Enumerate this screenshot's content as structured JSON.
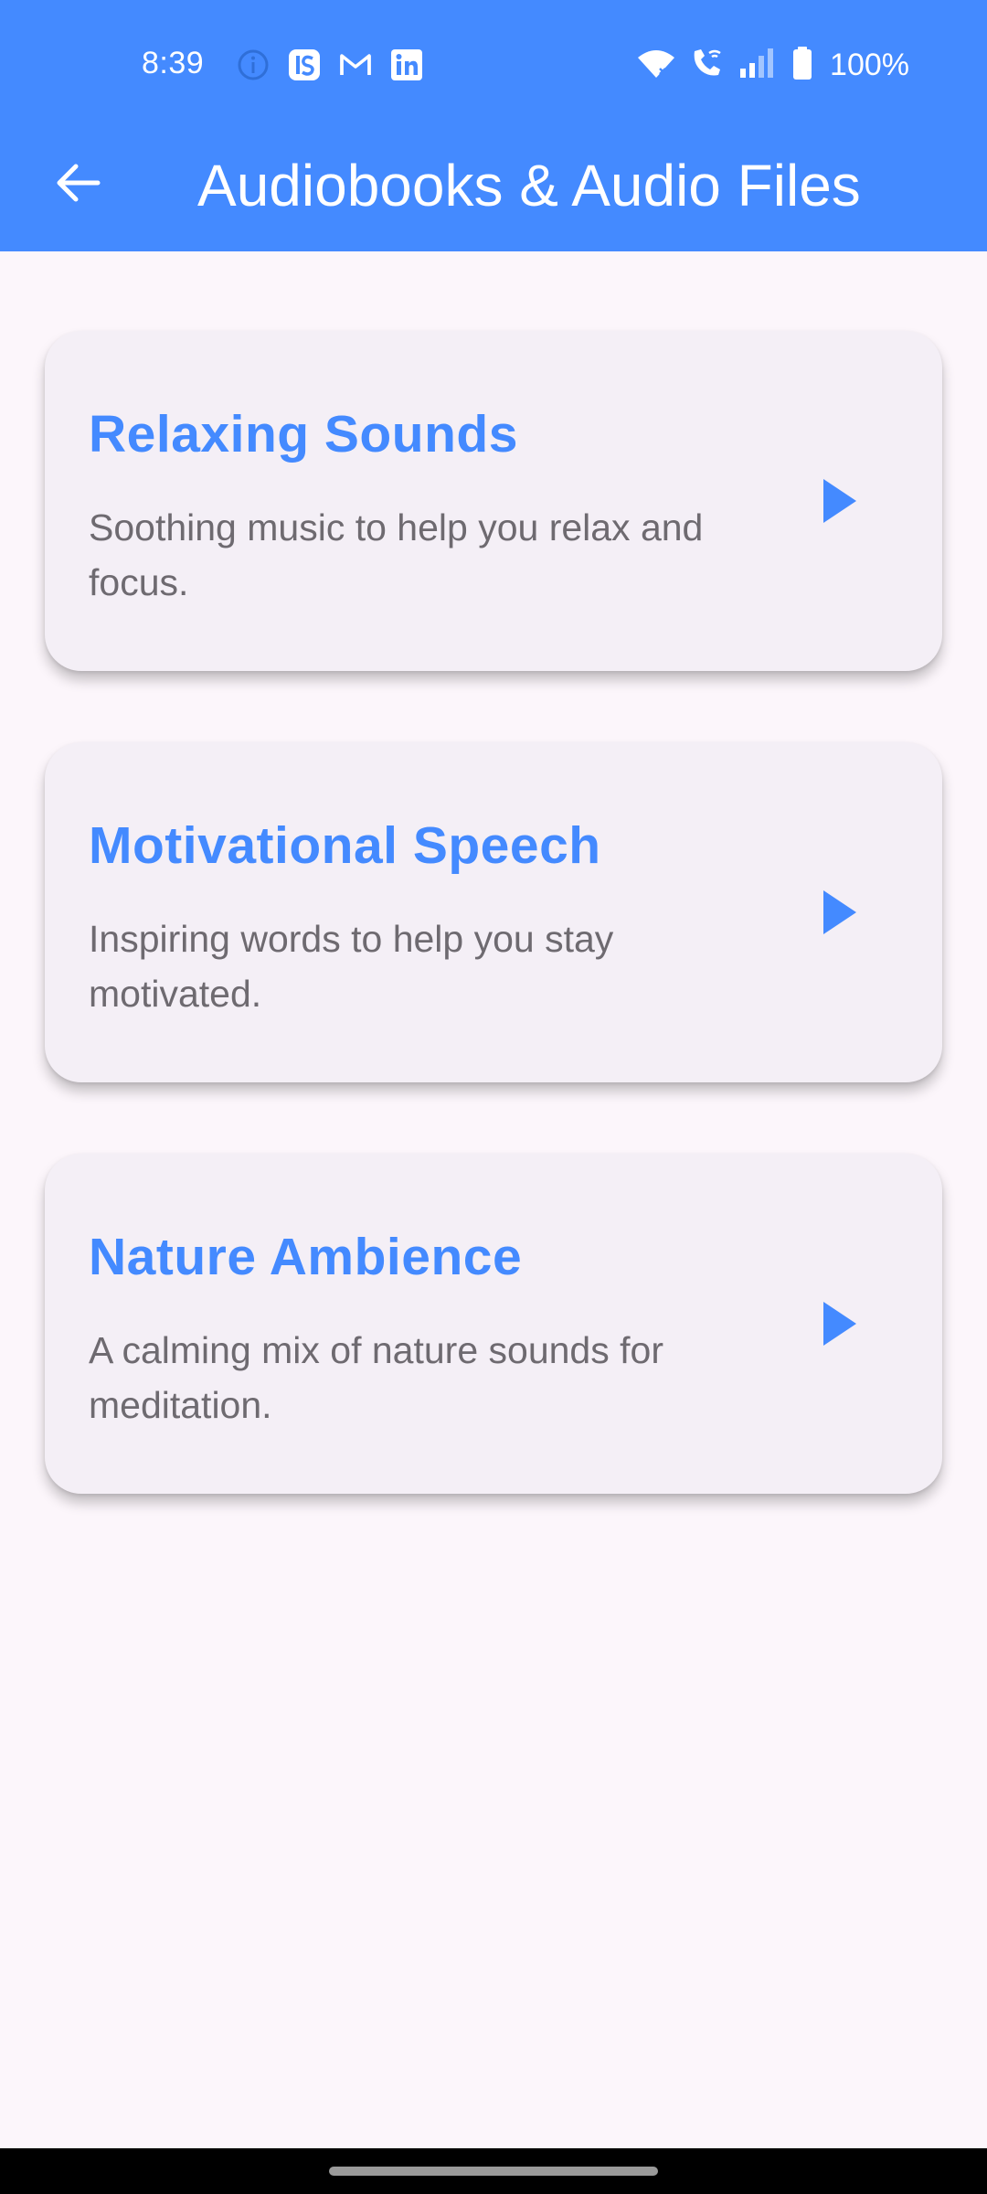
{
  "status_bar": {
    "time": "8:39",
    "battery": "100%",
    "notification_icons": [
      "info-icon",
      "instasaver-icon",
      "gmail-icon",
      "linkedin-icon"
    ],
    "system_icons": [
      "wifi-icon",
      "wifi-call-icon",
      "signal-icon",
      "battery-icon"
    ]
  },
  "app_bar": {
    "title": "Audiobooks & Audio Files",
    "back_icon": "arrow-back-icon",
    "color": "#448aff"
  },
  "tracks": [
    {
      "title": "Relaxing Sounds",
      "description": "Soothing music to help you relax and focus.",
      "action_icon": "play-icon"
    },
    {
      "title": "Motivational Speech",
      "description": "Inspiring words to help you stay motivated.",
      "action_icon": "play-icon"
    },
    {
      "title": "Nature Ambience",
      "description": "A calming mix of nature sounds for meditation.",
      "action_icon": "play-icon"
    }
  ],
  "colors": {
    "accent": "#448aff",
    "background": "#fcf6fb",
    "card": "#f4eff6",
    "description_text": "#6e6a70"
  }
}
